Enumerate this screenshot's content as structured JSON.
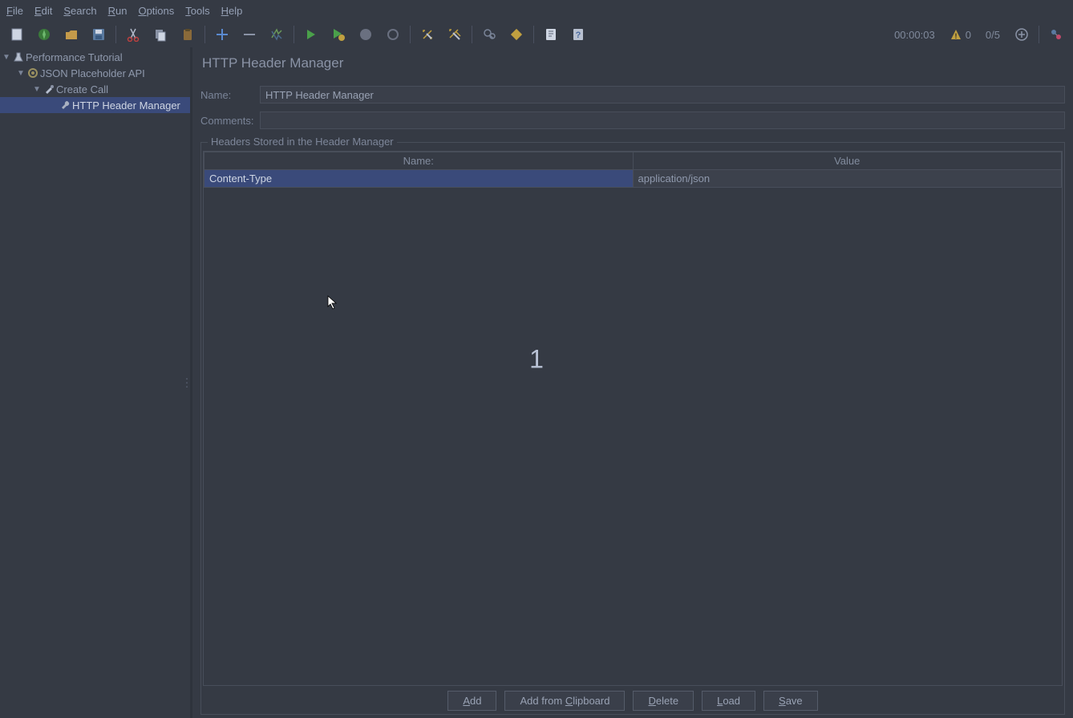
{
  "menu": {
    "file": "File",
    "edit": "Edit",
    "search": "Search",
    "run": "Run",
    "options": "Options",
    "tools": "Tools",
    "help": "Help"
  },
  "icons": {
    "new": "new",
    "templates": "templates",
    "open": "open",
    "save": "save",
    "cut": "cut",
    "copy": "copy",
    "paste": "paste",
    "expand": "expand",
    "collapse": "collapse",
    "toggle": "toggle",
    "start": "start",
    "start_no_timers": "start_no_timers",
    "stop": "stop",
    "shutdown": "shutdown",
    "clear": "clear",
    "clear_all": "clear_all",
    "search_tree": "search_tree",
    "reset_search": "reset_search",
    "fn": "fn",
    "help": "help"
  },
  "status": {
    "elapsed": "00:00:03",
    "warn_count": "0",
    "active_threads": "0/5"
  },
  "tree": {
    "test_plan": "Performance Tutorial",
    "thread_group": "JSON Placeholder API",
    "sampler": "Create Call",
    "header_mgr": "HTTP Header Manager"
  },
  "editor": {
    "title": "HTTP Header Manager",
    "name_label": "Name:",
    "name_value": "HTTP Header Manager",
    "comments_label": "Comments:",
    "comments_value": "",
    "group_title": "Headers Stored in the Header Manager",
    "col_name": "Name:",
    "col_value": "Value",
    "rows": [
      {
        "name": "Content-Type",
        "value": "application/json"
      }
    ],
    "buttons": {
      "add": "Add",
      "add_clipboard": "Add from Clipboard",
      "delete": "Delete",
      "load": "Load",
      "save": "Save"
    }
  },
  "overlay": {
    "center_text": "1"
  }
}
